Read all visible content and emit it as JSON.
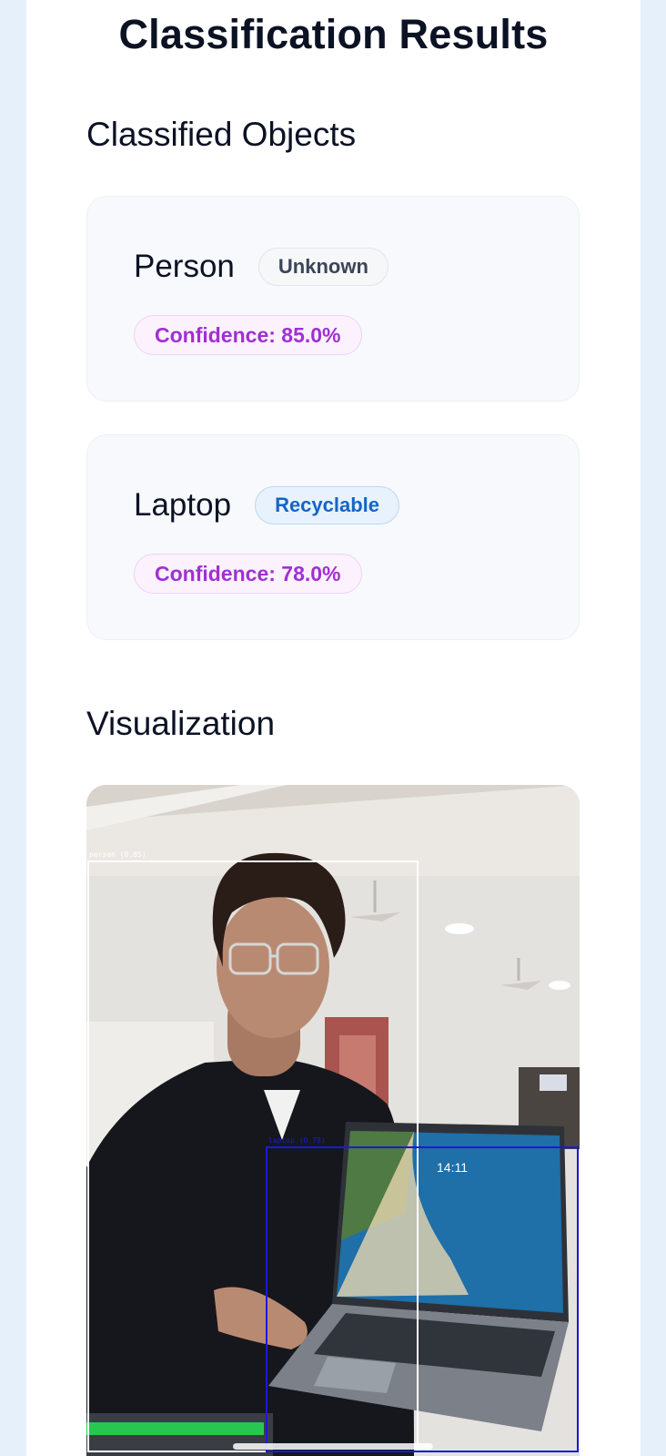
{
  "header": {
    "title": "Classification Results"
  },
  "classified": {
    "heading": "Classified Objects",
    "items": [
      {
        "name": "Person",
        "category": "Unknown",
        "confidence_text": "Confidence: 85.0%"
      },
      {
        "name": "Laptop",
        "category": "Recyclable",
        "confidence_text": "Confidence: 78.0%"
      }
    ]
  },
  "visualization": {
    "heading": "Visualization",
    "detections": [
      {
        "label": "person (0.85)",
        "color": "#ffffff"
      },
      {
        "label": "laptop (0.78)",
        "color": "#1a1ad9"
      }
    ],
    "laptop_screen_time": "14:11"
  },
  "colors": {
    "page_background": "#e6f0fa",
    "card_background": "#f7f9fc",
    "confidence_text": "#a12fd4",
    "recyclable_text": "#1565c7",
    "unknown_text": "#3b4556"
  }
}
